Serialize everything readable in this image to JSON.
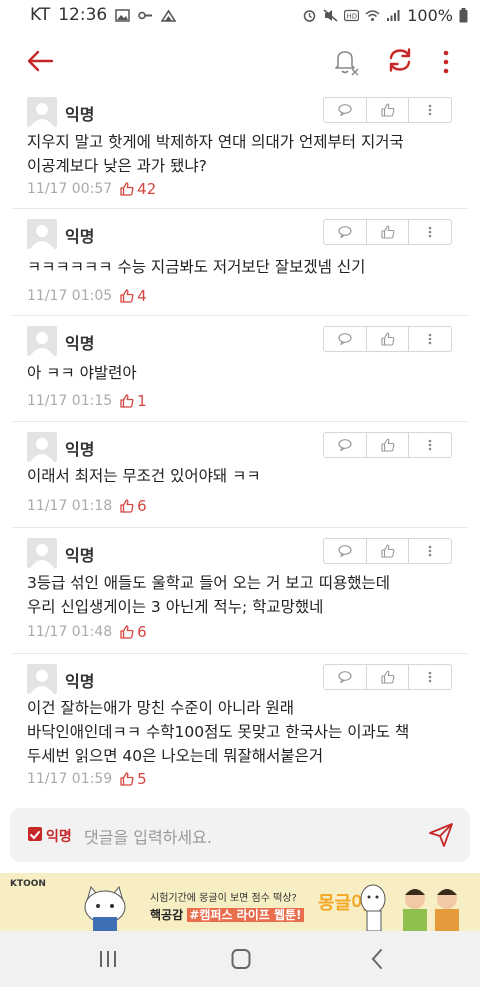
{
  "status_bar": {
    "carrier": "KT",
    "time": "12:36",
    "battery": "100%"
  },
  "app_bar": {
    "back_icon": "arrow-left-icon",
    "bell_icon": "bell-off-icon",
    "refresh_icon": "refresh-icon",
    "more_icon": "more-vertical-icon"
  },
  "comments": [
    {
      "author": "익명",
      "text": "지우지 말고 핫게에 박제하자 연대 의대가 언제부터 지거국\n이공계보다 낮은 과가 됐냐?",
      "time": "11/17 00:57",
      "likes": "42"
    },
    {
      "author": "익명",
      "text": "ㅋㅋㅋㅋㅋㅋ 수능 지금봐도 저거보단 잘보겠넴 신기",
      "time": "11/17 01:05",
      "likes": "4"
    },
    {
      "author": "익명",
      "text": "아 ㅋㅋ 야발련아",
      "time": "11/17 01:15",
      "likes": "1"
    },
    {
      "author": "익명",
      "text": "이래서 최저는 무조건 있어야돼 ㅋㅋ",
      "time": "11/17 01:18",
      "likes": "6"
    },
    {
      "author": "익명",
      "text": "3등급 섞인 애들도 울학교 들어 오는 거 보고 띠용했는데\n우리 신입생게이는 3 아닌게 적누; 학교망했네",
      "time": "11/17 01:48",
      "likes": "6"
    },
    {
      "author": "익명",
      "text": "이건 잘하는애가 망친 수준이 아니라 원래\n바닥인애인데ㅋㅋ 수학100점도 못맞고 한국사는 이과도 책\n두세번 읽으면 40은 나오는데 뭐잘해서붙은거",
      "time": "11/17 01:59",
      "likes": "5"
    }
  ],
  "input_bar": {
    "anonymous_label": "익명",
    "anonymous_checked": true,
    "placeholder": "댓글을 입력하세요."
  },
  "banner": {
    "brand": "KTOON",
    "line1": "시험기간에 몽글이 보면 점수 떡상?",
    "line2_prefix": "핵공감",
    "line2_highlight": "#캠퍼스 라이프 웹툰!",
    "logo_text": "몽글이"
  },
  "colors": {
    "accent": "#c62828",
    "like": "#d64541",
    "meta": "#aaaaaa",
    "banner_bg": "#f8eec4"
  }
}
